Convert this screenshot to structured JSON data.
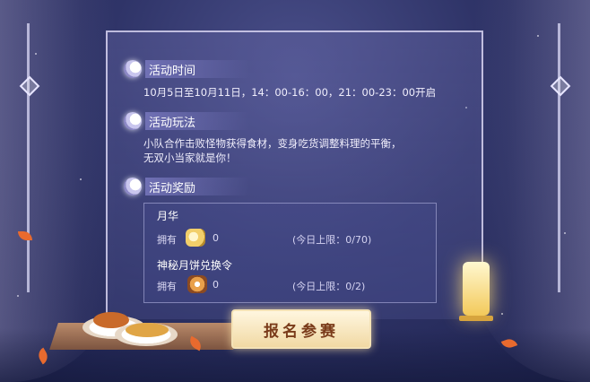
{
  "sections": {
    "time": {
      "title": "活动时间",
      "text": "10月5日至10月11日，14：00-16：00，21：00-23：00开启"
    },
    "gameplay": {
      "title": "活动玩法",
      "text_line1": "小队合作击败怪物获得食材，变身吃货调整料理的平衡，",
      "text_line2": "无双小当家就是你！"
    },
    "rewards": {
      "title": "活动奖励"
    }
  },
  "rewards": [
    {
      "name": "月华",
      "own_label": "拥有",
      "icon": "moon-essence-icon",
      "count": "0",
      "limit": "(今日上限：0/70)"
    },
    {
      "name": "神秘月饼兑换令",
      "own_label": "拥有",
      "icon": "mooncake-token-icon",
      "count": "0",
      "limit": "(今日上限：0/2)"
    }
  ],
  "join_button": {
    "label": "报名参赛"
  }
}
